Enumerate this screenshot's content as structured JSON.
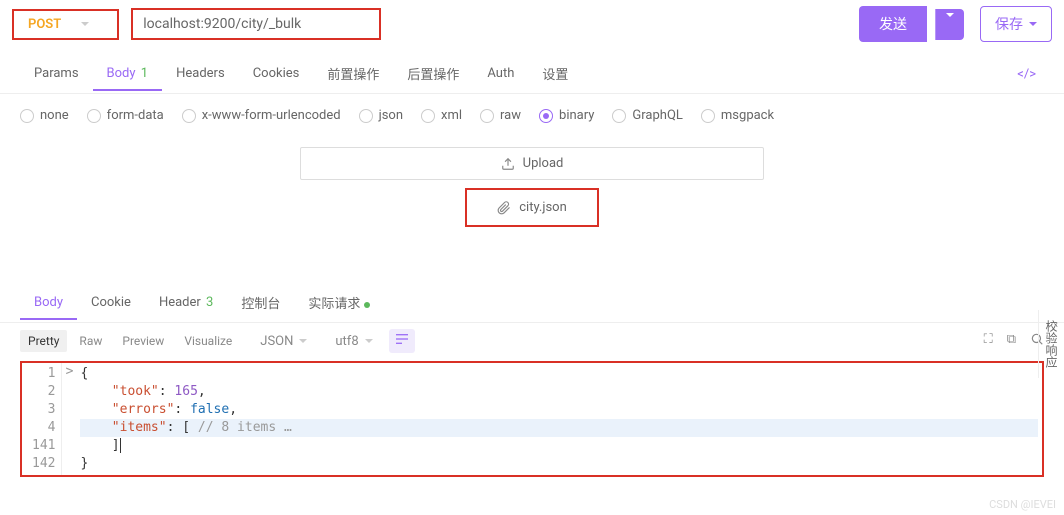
{
  "request": {
    "method": "POST",
    "url": "localhost:9200/city/_bulk",
    "send_label": "发送",
    "save_label": "保存"
  },
  "tabs": {
    "params": "Params",
    "body": "Body",
    "body_count": "1",
    "headers": "Headers",
    "cookies": "Cookies",
    "pre": "前置操作",
    "post": "后置操作",
    "auth": "Auth",
    "settings": "设置"
  },
  "body_types": {
    "none": "none",
    "formdata": "form-data",
    "urlencoded": "x-www-form-urlencoded",
    "json": "json",
    "xml": "xml",
    "raw": "raw",
    "binary": "binary",
    "graphql": "GraphQL",
    "msgpack": "msgpack",
    "selected": "binary"
  },
  "upload": {
    "label": "Upload",
    "file": "city.json"
  },
  "response_tabs": {
    "body": "Body",
    "cookie": "Cookie",
    "header": "Header",
    "header_count": "3",
    "console": "控制台",
    "actual": "实际请求"
  },
  "view": {
    "pretty": "Pretty",
    "raw": "Raw",
    "preview": "Preview",
    "visualize": "Visualize",
    "format": "JSON",
    "encoding": "utf8"
  },
  "code_lines": [
    {
      "n": "1",
      "content": "{"
    },
    {
      "n": "2",
      "content": "    \"took\": 165,"
    },
    {
      "n": "3",
      "content": "    \"errors\": false,"
    },
    {
      "n": "4",
      "content": "    \"items\": [ // 8 items …",
      "fold": ">"
    },
    {
      "n": "141",
      "content": "    ]"
    },
    {
      "n": "142",
      "content": "}"
    }
  ],
  "side_panel": "校验响应",
  "watermark": "CSDN @IEVEI"
}
